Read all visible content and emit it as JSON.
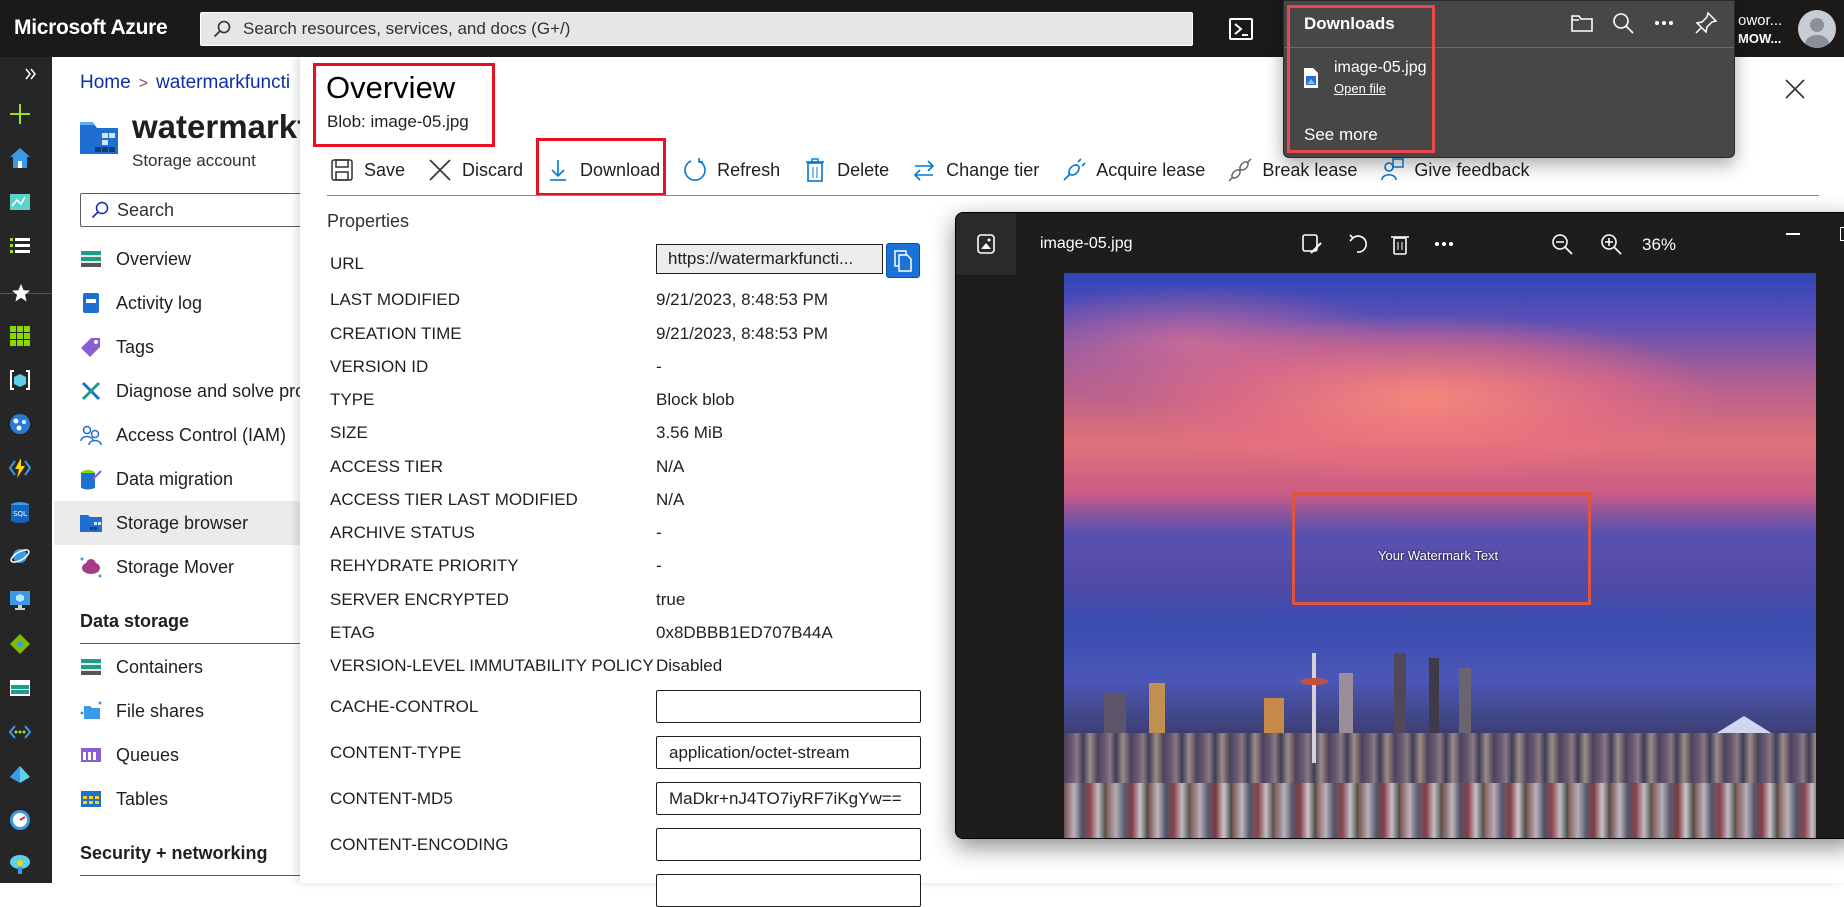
{
  "topbar": {
    "brand": "Microsoft Azure",
    "search_placeholder": "Search resources, services, and docs (G+/)",
    "account_line1": "owor...",
    "account_line2": "MOW..."
  },
  "rail": {
    "icons": [
      "expand-icon",
      "create-resource-icon",
      "home-icon",
      "dashboard-icon",
      "all-services-icon",
      "favorites-icon",
      "all-resources-icon",
      "resource-groups-icon",
      "app-services-icon",
      "function-app-icon",
      "sql-database-icon",
      "cosmos-db-icon",
      "virtual-machines-icon",
      "load-balancer-icon",
      "storage-accounts-icon",
      "virtual-networks-icon",
      "entra-id-icon",
      "monitor-icon",
      "advisor-icon"
    ]
  },
  "blade": {
    "breadcrumb": [
      "Home",
      "watermarkfuncti"
    ],
    "resource_name": "watermarkf",
    "resource_type": "Storage account",
    "search_placeholder": "Search",
    "menu": [
      {
        "label": "Overview",
        "icon": "overview-icon"
      },
      {
        "label": "Activity log",
        "icon": "activity-log-icon"
      },
      {
        "label": "Tags",
        "icon": "tag-icon"
      },
      {
        "label": "Diagnose and solve pro",
        "icon": "wrench-icon"
      },
      {
        "label": "Access Control (IAM)",
        "icon": "people-icon"
      },
      {
        "label": "Data migration",
        "icon": "data-migration-icon"
      },
      {
        "label": "Storage browser",
        "icon": "storage-browser-icon",
        "active": true
      },
      {
        "label": "Storage Mover",
        "icon": "cloud-icon"
      }
    ],
    "section_data_storage": "Data storage",
    "data_storage_menu": [
      {
        "label": "Containers",
        "icon": "containers-icon"
      },
      {
        "label": "File shares",
        "icon": "file-shares-icon"
      },
      {
        "label": "Queues",
        "icon": "queues-icon"
      },
      {
        "label": "Tables",
        "icon": "tables-icon"
      }
    ],
    "section_security": "Security + networking"
  },
  "pane": {
    "title": "Overview",
    "subtitle": "Blob: image-05.jpg",
    "toolbar": {
      "save": "Save",
      "discard": "Discard",
      "download": "Download",
      "refresh": "Refresh",
      "delete": "Delete",
      "change_tier": "Change tier",
      "acquire_lease": "Acquire lease",
      "break_lease": "Break lease",
      "give_feedback": "Give feedback"
    },
    "properties_heading": "Properties",
    "url_label": "URL",
    "url_value": "https://watermarkfuncti...",
    "properties": [
      {
        "label": "LAST MODIFIED",
        "value": "9/21/2023, 8:48:53 PM"
      },
      {
        "label": "CREATION TIME",
        "value": "9/21/2023, 8:48:53 PM"
      },
      {
        "label": "VERSION ID",
        "value": "-"
      },
      {
        "label": "TYPE",
        "value": "Block blob"
      },
      {
        "label": "SIZE",
        "value": "3.56 MiB"
      },
      {
        "label": "ACCESS TIER",
        "value": "N/A"
      },
      {
        "label": "ACCESS TIER LAST MODIFIED",
        "value": "N/A"
      },
      {
        "label": "ARCHIVE STATUS",
        "value": "-"
      },
      {
        "label": "REHYDRATE PRIORITY",
        "value": "-"
      },
      {
        "label": "SERVER ENCRYPTED",
        "value": "true"
      },
      {
        "label": "ETAG",
        "value": "0x8DBBB1ED707B44A"
      },
      {
        "label": "VERSION-LEVEL IMMUTABILITY POLICY",
        "value": "Disabled"
      }
    ],
    "editable_properties": [
      {
        "label": "CACHE-CONTROL",
        "value": ""
      },
      {
        "label": "CONTENT-TYPE",
        "value": "application/octet-stream"
      },
      {
        "label": "CONTENT-MD5",
        "value": "MaDkr+nJ4TO7iyRF7iKgYw=="
      },
      {
        "label": "CONTENT-ENCODING",
        "value": ""
      }
    ]
  },
  "downloads": {
    "title": "Downloads",
    "file_name": "image-05.jpg",
    "open_file": "Open file",
    "see_more": "See more"
  },
  "viewer": {
    "file_name": "image-05.jpg",
    "zoom": "36%",
    "watermark_text": "Your Watermark Text"
  },
  "colors": {
    "highlight_red": "#e81123",
    "azure_blue": "#0078d4",
    "topbar_bg": "#1b1a19"
  }
}
